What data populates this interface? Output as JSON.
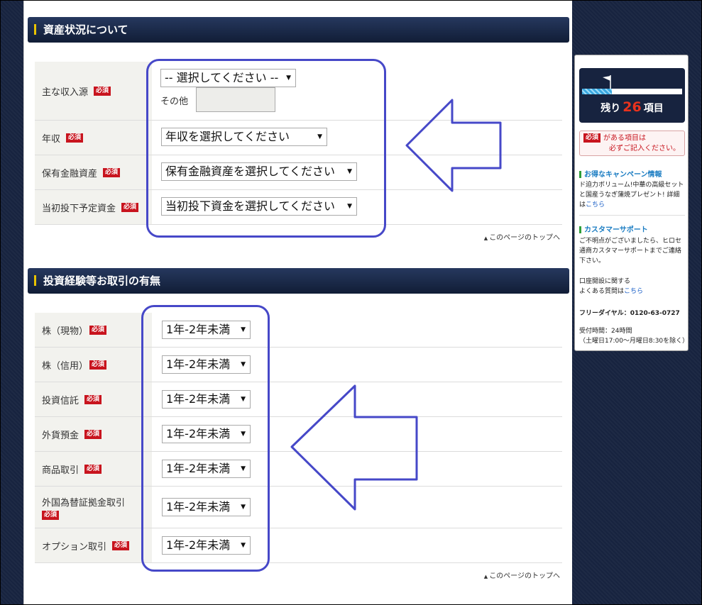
{
  "section1": {
    "title": "資産状況について",
    "rows": [
      {
        "label": "主な収入源",
        "value": "-- 選択してください --"
      },
      {
        "label": "年収",
        "value": "年収を選択してください"
      },
      {
        "label": "保有金融資産",
        "value": "保有金融資産を選択してください"
      },
      {
        "label": "当初投下予定資金",
        "value": "当初投下資金を選択してください"
      }
    ],
    "other_label": "その他"
  },
  "section2": {
    "title": "投資経験等お取引の有無",
    "rows": [
      {
        "label": "株（現物）",
        "value": "1年-2年未満"
      },
      {
        "label": "株（信用）",
        "value": "1年-2年未満"
      },
      {
        "label": "投資信託",
        "value": "1年-2年未満"
      },
      {
        "label": "外貨預金",
        "value": "1年-2年未満"
      },
      {
        "label": "商品取引",
        "value": "1年-2年未満"
      },
      {
        "label": "外国為替証拠金取引",
        "value": "1年-2年未満"
      },
      {
        "label": "オプション取引",
        "value": "1年-2年未満"
      }
    ]
  },
  "required_badge": "必須",
  "to_top": "このページのトップへ",
  "sidebar": {
    "remaining_prefix": "残り",
    "remaining_count": "26",
    "remaining_suffix": "項目",
    "progress_fraction": 0.3,
    "req_note_line1": "がある項目は",
    "req_note_line2": "必ずご記入ください。",
    "campaign_heading": "お得なキャンペーン情報",
    "campaign_text": "ド迫力ボリューム!中華の高級セットと国産うなぎ蒲焼プレゼント! 詳細は",
    "campaign_link": "こちら",
    "support_heading": "カスタマーサポート",
    "support_text": "ご不明点がございましたら、ヒロセ通商カスタマーサポートまでご連絡下さい。",
    "faq_text": "口座開設に関する\nよくある質問は",
    "faq_link": "こちら",
    "free_dial": "フリーダイヤル：0120-63-0727",
    "hours": "受付時間：24時間",
    "hours_note": "（土曜日17:00〜月曜日8:30を除く）"
  },
  "colors": {
    "background": "#17233f",
    "header": "#1b2a4a",
    "required": "#c8141e",
    "annotation": "#4648c8",
    "remaining_number": "#e8321d"
  }
}
